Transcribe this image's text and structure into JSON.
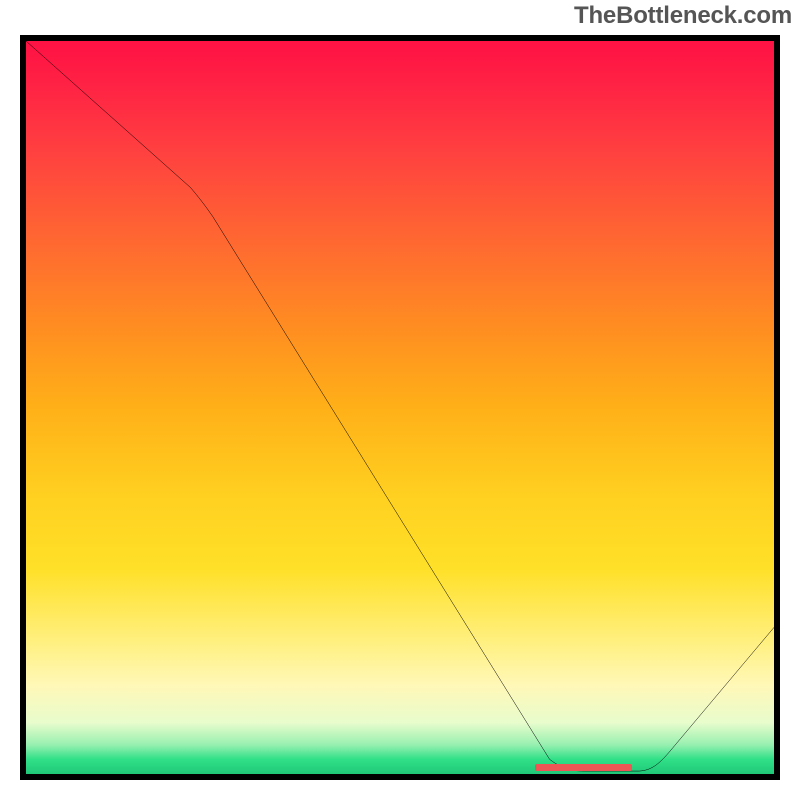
{
  "watermark": "TheBottleneck.com",
  "chart_data": {
    "type": "line",
    "title": "",
    "xlabel": "",
    "ylabel": "",
    "xlim": [
      0,
      100
    ],
    "ylim": [
      0,
      100
    ],
    "x": [
      0,
      22,
      70,
      75,
      82,
      100
    ],
    "values": [
      100,
      80,
      2,
      0,
      0,
      20
    ],
    "note": "Single black curve over a vertical red-to-green gradient background. X values are reported as percentages of plot width; Y values as percentages of plot height (value 0 = bottom of the plot). The curve starts at the top-left, descends linearly with a slight inflection near x≈22, reaches a flat bottom around x≈70–82, then rises to the right edge. No axis labels, ticks, or gridlines are present.",
    "annotations": [
      {
        "kind": "marker-bar",
        "x_start": 70,
        "x_end": 82,
        "y": 0,
        "color": "#ee5555"
      }
    ],
    "gradient_stops": [
      {
        "pct": 0,
        "color": "#ff1144"
      },
      {
        "pct": 50,
        "color": "#ffb018"
      },
      {
        "pct": 90,
        "color": "#fff8b8"
      },
      {
        "pct": 100,
        "color": "#20c878"
      }
    ]
  }
}
